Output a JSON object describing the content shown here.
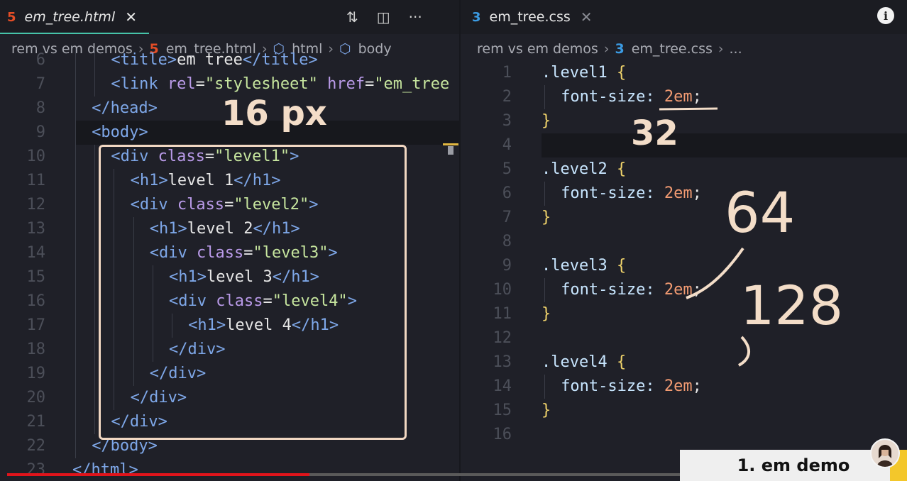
{
  "left_editor": {
    "tab": {
      "icon": "html5-icon",
      "title": "em_tree.html",
      "close": "✕"
    },
    "actions": {
      "compare": "⇅",
      "split": "◫",
      "more": "···"
    },
    "breadcrumb": {
      "folder": "rem vs em demos",
      "file": "em_tree.html",
      "node1": "html",
      "node2": "body"
    },
    "lines": [
      {
        "n": "6",
        "indent": 4,
        "parts": [
          [
            "t-tag",
            "<title>"
          ],
          [
            "",
            "em tree"
          ],
          [
            "t-tag",
            "</title>"
          ]
        ]
      },
      {
        "n": "7",
        "indent": 4,
        "parts": [
          [
            "t-tag",
            "<link "
          ],
          [
            "t-attr",
            "rel"
          ],
          [
            "",
            "="
          ],
          [
            "t-str",
            "\"stylesheet\""
          ],
          [
            "",
            " "
          ],
          [
            "t-attr",
            "href"
          ],
          [
            "",
            "="
          ],
          [
            "t-str",
            "\"em_tree"
          ]
        ]
      },
      {
        "n": "8",
        "indent": 2,
        "parts": [
          [
            "t-tag",
            "</head>"
          ]
        ]
      },
      {
        "n": "9",
        "indent": 2,
        "parts": [
          [
            "t-tag",
            "<body>"
          ]
        ]
      },
      {
        "n": "10",
        "indent": 4,
        "parts": [
          [
            "t-tag",
            "<div "
          ],
          [
            "t-attr",
            "class"
          ],
          [
            "",
            "="
          ],
          [
            "t-str",
            "\"level1\""
          ],
          [
            "t-tag",
            ">"
          ]
        ]
      },
      {
        "n": "11",
        "indent": 6,
        "parts": [
          [
            "t-tag",
            "<h1>"
          ],
          [
            "",
            "level 1"
          ],
          [
            "t-tag",
            "</h1>"
          ]
        ]
      },
      {
        "n": "12",
        "indent": 6,
        "parts": [
          [
            "t-tag",
            "<div "
          ],
          [
            "t-attr",
            "class"
          ],
          [
            "",
            "="
          ],
          [
            "t-str",
            "\"level2\""
          ],
          [
            "t-tag",
            ">"
          ]
        ]
      },
      {
        "n": "13",
        "indent": 8,
        "parts": [
          [
            "t-tag",
            "<h1>"
          ],
          [
            "",
            "level 2"
          ],
          [
            "t-tag",
            "</h1>"
          ]
        ]
      },
      {
        "n": "14",
        "indent": 8,
        "parts": [
          [
            "t-tag",
            "<div "
          ],
          [
            "t-attr",
            "class"
          ],
          [
            "",
            "="
          ],
          [
            "t-str",
            "\"level3\""
          ],
          [
            "t-tag",
            ">"
          ]
        ]
      },
      {
        "n": "15",
        "indent": 10,
        "parts": [
          [
            "t-tag",
            "<h1>"
          ],
          [
            "",
            "level 3"
          ],
          [
            "t-tag",
            "</h1>"
          ]
        ]
      },
      {
        "n": "16",
        "indent": 10,
        "parts": [
          [
            "t-tag",
            "<div "
          ],
          [
            "t-attr",
            "class"
          ],
          [
            "",
            "="
          ],
          [
            "t-str",
            "\"level4\""
          ],
          [
            "t-tag",
            ">"
          ]
        ]
      },
      {
        "n": "17",
        "indent": 12,
        "parts": [
          [
            "t-tag",
            "<h1>"
          ],
          [
            "",
            "level 4"
          ],
          [
            "t-tag",
            "</h1>"
          ]
        ]
      },
      {
        "n": "18",
        "indent": 10,
        "parts": [
          [
            "t-tag",
            "</div>"
          ]
        ]
      },
      {
        "n": "19",
        "indent": 8,
        "parts": [
          [
            "t-tag",
            "</div>"
          ]
        ]
      },
      {
        "n": "20",
        "indent": 6,
        "parts": [
          [
            "t-tag",
            "</div>"
          ]
        ]
      },
      {
        "n": "21",
        "indent": 4,
        "parts": [
          [
            "t-tag",
            "</div>"
          ]
        ]
      },
      {
        "n": "22",
        "indent": 2,
        "parts": [
          [
            "t-tag",
            "</body>"
          ]
        ]
      },
      {
        "n": "23",
        "indent": 0,
        "parts": [
          [
            "t-tag",
            "</html>"
          ]
        ]
      }
    ]
  },
  "right_editor": {
    "tab": {
      "icon": "css3-icon",
      "title": "em_tree.css",
      "close": "✕"
    },
    "breadcrumb": {
      "folder": "rem vs em demos",
      "file": "em_tree.css",
      "more": "..."
    },
    "lines": [
      {
        "n": "1",
        "indent": 0,
        "parts": [
          [
            "t-cls",
            ".level1 "
          ],
          [
            "t-brace",
            "{"
          ]
        ]
      },
      {
        "n": "2",
        "indent": 2,
        "parts": [
          [
            "t-prop",
            "font-size: "
          ],
          [
            "t-num",
            "2em"
          ],
          [
            "",
            ";"
          ]
        ]
      },
      {
        "n": "3",
        "indent": 0,
        "parts": [
          [
            "t-brace",
            "}"
          ]
        ]
      },
      {
        "n": "4",
        "indent": 0,
        "parts": []
      },
      {
        "n": "5",
        "indent": 0,
        "parts": [
          [
            "t-cls",
            ".level2 "
          ],
          [
            "t-brace",
            "{"
          ]
        ]
      },
      {
        "n": "6",
        "indent": 2,
        "parts": [
          [
            "t-prop",
            "font-size: "
          ],
          [
            "t-num",
            "2em"
          ],
          [
            "",
            ";"
          ]
        ]
      },
      {
        "n": "7",
        "indent": 0,
        "parts": [
          [
            "t-brace",
            "}"
          ]
        ]
      },
      {
        "n": "8",
        "indent": 0,
        "parts": []
      },
      {
        "n": "9",
        "indent": 0,
        "parts": [
          [
            "t-cls",
            ".level3 "
          ],
          [
            "t-brace",
            "{"
          ]
        ]
      },
      {
        "n": "10",
        "indent": 2,
        "parts": [
          [
            "t-prop",
            "font-size: "
          ],
          [
            "t-num",
            "2em"
          ],
          [
            "",
            ";"
          ]
        ]
      },
      {
        "n": "11",
        "indent": 0,
        "parts": [
          [
            "t-brace",
            "}"
          ]
        ]
      },
      {
        "n": "12",
        "indent": 0,
        "parts": []
      },
      {
        "n": "13",
        "indent": 0,
        "parts": [
          [
            "t-cls",
            ".level4 "
          ],
          [
            "t-brace",
            "{"
          ]
        ]
      },
      {
        "n": "14",
        "indent": 2,
        "parts": [
          [
            "t-prop",
            "font-size: "
          ],
          [
            "t-num",
            "2em"
          ],
          [
            "",
            ";"
          ]
        ]
      },
      {
        "n": "15",
        "indent": 0,
        "parts": [
          [
            "t-brace",
            "}"
          ]
        ]
      },
      {
        "n": "16",
        "indent": 0,
        "parts": []
      }
    ]
  },
  "annotations": {
    "base": "16 px",
    "a32": "32",
    "a64": "64",
    "a128": "128"
  },
  "video": {
    "chapter_label": "1. em demo",
    "progress_fraction": 0.34,
    "accent": "#e0141b"
  },
  "colors": {
    "html_icon": "#e44d26",
    "css_icon": "#3b9be3"
  }
}
